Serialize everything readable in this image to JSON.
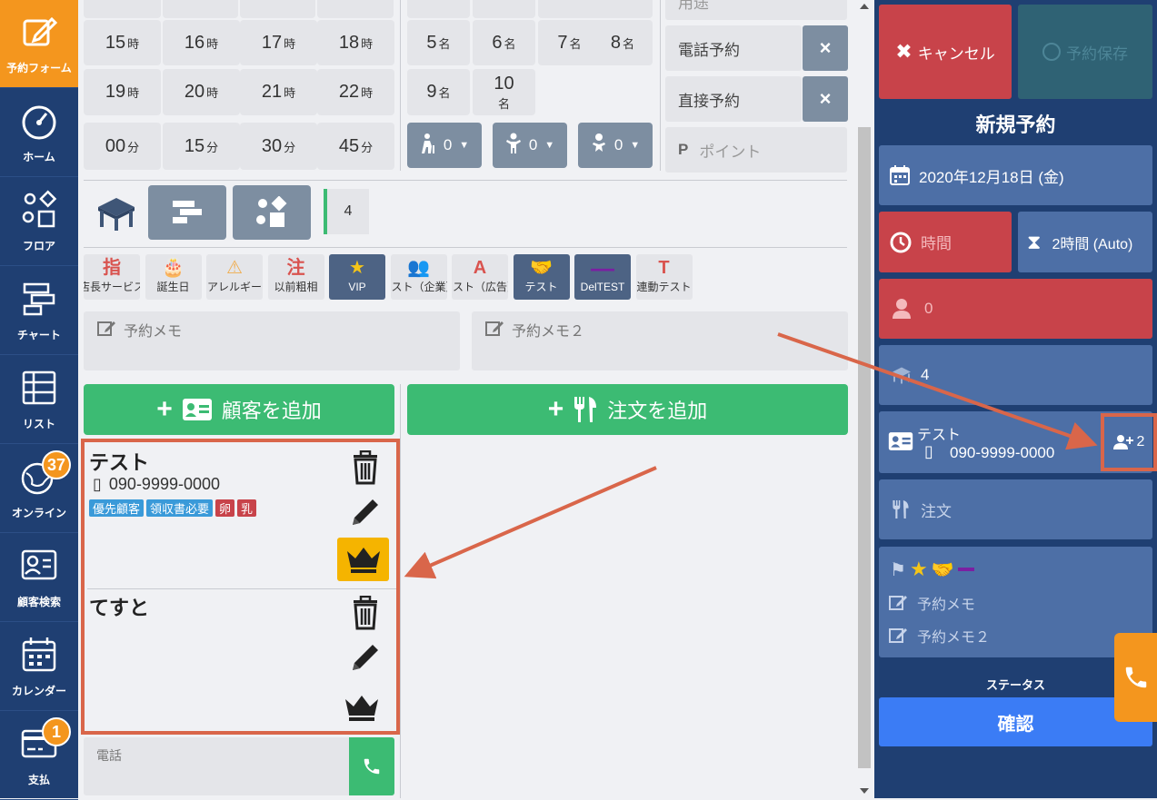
{
  "sidebar": {
    "items": [
      {
        "label": "予約フォーム",
        "icon": "edit-form-icon",
        "active": true
      },
      {
        "label": "ホーム",
        "icon": "dashboard-icon"
      },
      {
        "label": "フロア",
        "icon": "floor-shapes-icon"
      },
      {
        "label": "チャート",
        "icon": "chart-bars-icon"
      },
      {
        "label": "リスト",
        "icon": "list-table-icon"
      },
      {
        "label": "オンライン",
        "icon": "globe-icon",
        "badge": "37"
      },
      {
        "label": "顧客検索",
        "icon": "customer-card-icon"
      },
      {
        "label": "カレンダー",
        "icon": "calendar-icon"
      },
      {
        "label": "支払",
        "icon": "credit-card-icon",
        "badge": "1"
      }
    ]
  },
  "time": {
    "hours_row1": [
      {
        "n": "15",
        "u": "時"
      },
      {
        "n": "16",
        "u": "時"
      },
      {
        "n": "17",
        "u": "時"
      },
      {
        "n": "18",
        "u": "時"
      }
    ],
    "hours_row2": [
      {
        "n": "19",
        "u": "時"
      },
      {
        "n": "20",
        "u": "時"
      },
      {
        "n": "21",
        "u": "時"
      },
      {
        "n": "22",
        "u": "時"
      }
    ],
    "minutes": [
      {
        "n": "00",
        "u": "分"
      },
      {
        "n": "15",
        "u": "分"
      },
      {
        "n": "30",
        "u": "分"
      },
      {
        "n": "45",
        "u": "分"
      }
    ]
  },
  "people": {
    "row1": [
      {
        "n": "5",
        "u": "名"
      },
      {
        "n": "6",
        "u": "名"
      },
      {
        "n": "7",
        "u": "名"
      },
      {
        "n": "8",
        "u": "名"
      }
    ],
    "row2": [
      {
        "n": "9",
        "u": "名"
      },
      {
        "n": "10",
        "u": "名"
      }
    ],
    "dropdowns": [
      {
        "icon": "elderly-icon",
        "value": "0"
      },
      {
        "icon": "child-icon",
        "value": "0"
      },
      {
        "icon": "baby-icon",
        "value": "0"
      }
    ]
  },
  "source": {
    "purpose_placeholder": "用途",
    "phone": "電話予約",
    "direct": "直接予約",
    "points_placeholder": "ポイント",
    "remove": "×"
  },
  "seating": {
    "count": "4"
  },
  "tags": [
    {
      "icon": "指",
      "label": "店長サービス",
      "color": "#d9534f"
    },
    {
      "icon": "🎂",
      "label": "誕生日",
      "color": "#d9534f"
    },
    {
      "icon": "⚠",
      "label": "アレルギー",
      "color": "#f0ad4e"
    },
    {
      "icon": "注",
      "label": "以前粗相",
      "color": "#d9534f"
    },
    {
      "icon": "★",
      "label": "VIP",
      "color": "#f5c518",
      "selected": true
    },
    {
      "icon": "👥",
      "label": "テスト（企業）",
      "color": "#8bc34a"
    },
    {
      "icon": "A",
      "label": "テスト（広告）",
      "color": "#d9534f"
    },
    {
      "icon": "🤝",
      "label": "テスト",
      "color": "#f08030",
      "selected": true
    },
    {
      "icon": "—",
      "label": "DelTEST",
      "color": "#7b1fa2",
      "selected": true
    },
    {
      "icon": "T",
      "label": "連動テスト",
      "color": "#d9534f"
    }
  ],
  "memo": {
    "memo1": "予約メモ",
    "memo2": "予約メモ２"
  },
  "actions": {
    "add_customer": "顧客を追加",
    "add_order": "注文を追加"
  },
  "customers": [
    {
      "name": "テスト",
      "phone": "090-9999-0000",
      "tags": [
        {
          "t": "優先顧客",
          "c": "#3a9ad9"
        },
        {
          "t": "領収書必要",
          "c": "#3a9ad9"
        },
        {
          "t": "卵",
          "c": "#c8434a"
        },
        {
          "t": "乳",
          "c": "#c8434a"
        }
      ],
      "primary": true
    },
    {
      "name": "てすと",
      "phone": "",
      "tags": [],
      "primary": false
    }
  ],
  "phone_input": {
    "placeholder": "電話"
  },
  "panel": {
    "cancel": "キャンセル",
    "save": "予約保存",
    "title": "新規予約",
    "date": "2020年12月18日 (金)",
    "time": "時間",
    "duration": "2時間 (Auto)",
    "people": "0",
    "table": "4",
    "customer_name": "テスト",
    "customer_phone": "090-9999-0000",
    "guest_count": "2",
    "order": "注文",
    "memo1": "予約メモ",
    "memo2": "予約メモ２",
    "status_label": "ステータス",
    "status": "確認"
  }
}
